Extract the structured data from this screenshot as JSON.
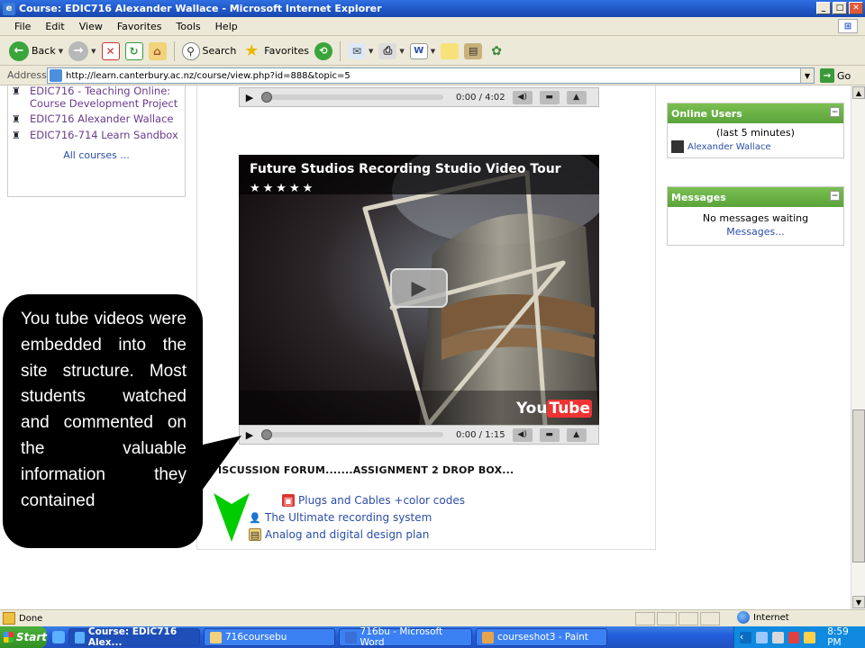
{
  "window": {
    "title": "Course: EDIC716 Alexander Wallace - Microsoft Internet Explorer",
    "app_icon": "e"
  },
  "menu": [
    "File",
    "Edit",
    "View",
    "Favorites",
    "Tools",
    "Help"
  ],
  "toolbar": {
    "back_label": "Back",
    "search_label": "Search",
    "favorites_label": "Favorites"
  },
  "address": {
    "label": "Address",
    "url": "http://learn.canterbury.ac.nz/course/view.php?id=888&topic=5",
    "go_label": "Go"
  },
  "left_block": {
    "courses": [
      "EDIC716 - Teaching Online: Course Development Project",
      "EDIC716 Alexander Wallace",
      "EDIC716-714 Learn Sandbox"
    ],
    "all_courses": "All courses ..."
  },
  "players": {
    "top_time": "0:00 / 4:02",
    "bottom_time": "0:00 / 1:15"
  },
  "video": {
    "title": "Future Studios Recording Studio Video Tour",
    "rating_stars": "★★★★★",
    "logo_you": "You",
    "logo_tube": "Tube"
  },
  "forum_line": "ISCUSSION FORUM.......ASSIGNMENT 2 DROP BOX...",
  "resources": [
    "Plugs and Cables +color codes",
    "The Ultimate recording system",
    "Analog and digital design plan"
  ],
  "online_users": {
    "header": "Online Users",
    "period": "(last 5 minutes)",
    "user": "Alexander Wallace"
  },
  "messages": {
    "header": "Messages",
    "status": "No messages waiting",
    "link": "Messages..."
  },
  "callout_text": "You tube videos were embedded into the site structure. Most students watched and commented on the valuable information they contained",
  "status": {
    "text": "Done",
    "zone": "Internet"
  },
  "taskbar": {
    "start": "Start",
    "tasks": [
      "Course: EDIC716 Alex...",
      "716coursebu",
      "716bu - Microsoft Word",
      "courseshot3 - Paint"
    ],
    "clock": "8:59 PM"
  },
  "colors": {
    "block_header": "#5aa33a",
    "link": "#2a4da8",
    "visited_link": "#6b3a8f",
    "callout_bg": "#000000",
    "arrow_green": "#00cc00"
  }
}
